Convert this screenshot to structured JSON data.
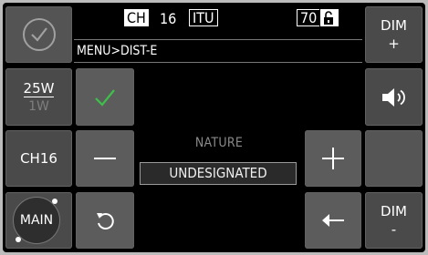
{
  "status": {
    "channel_tag": "CH",
    "channel_number": "16",
    "band": "ITU",
    "power_level": "70"
  },
  "breadcrumb": "MENU>DIST-E",
  "left": {
    "power_high": "25W",
    "power_low": "1W",
    "channel_button": "CH16",
    "main_button": "MAIN"
  },
  "right": {
    "dim_plus_top": "DIM",
    "dim_plus_bottom": "+",
    "dim_minus_top": "DIM",
    "dim_minus_bottom": "-"
  },
  "field": {
    "label": "NATURE",
    "value": "UNDESIGNATED"
  },
  "icons": {
    "circle_check": "circle-check-icon",
    "check": "check-icon",
    "minus": "minus-icon",
    "plus": "plus-icon",
    "undo": "undo-icon",
    "back_arrow": "back-arrow-icon",
    "speaker": "speaker-icon",
    "lock": "unlock-icon"
  },
  "colors": {
    "accent_green": "#3ec04b",
    "button_gray": "#545454",
    "screen": "#000000"
  }
}
